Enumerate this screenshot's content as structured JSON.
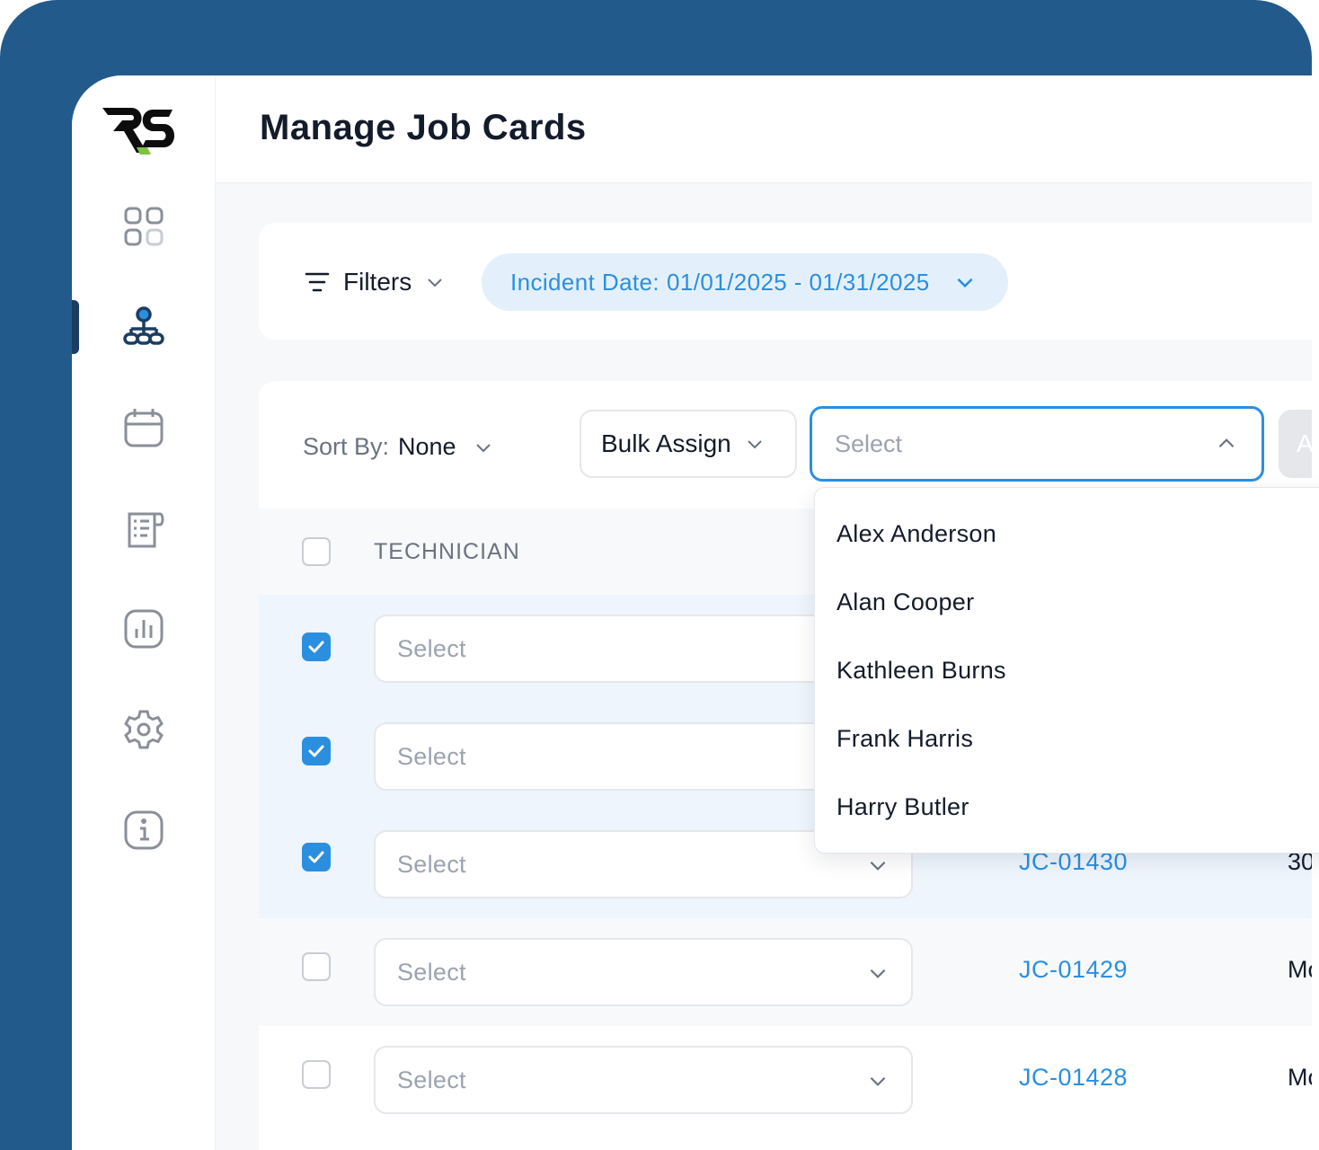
{
  "header": {
    "title": "Manage Job Cards"
  },
  "sidebar": {
    "items": [
      {
        "name": "dashboard",
        "icon": "grid-icon"
      },
      {
        "name": "job-cards",
        "icon": "org-chart-icon",
        "active": true
      },
      {
        "name": "calendar",
        "icon": "calendar-icon"
      },
      {
        "name": "documents",
        "icon": "document-icon"
      },
      {
        "name": "reports",
        "icon": "bar-chart-icon"
      },
      {
        "name": "settings",
        "icon": "gear-icon"
      },
      {
        "name": "info",
        "icon": "info-icon"
      }
    ]
  },
  "filters": {
    "label": "Filters",
    "date_chip_label": "Incident Date:",
    "date_chip_value": "01/01/2025 - 01/31/2025"
  },
  "toolbar": {
    "sort_label": "Sort By:",
    "sort_value": "None",
    "bulk_assign_label": "Bulk Assign",
    "technician_select_placeholder": "Select",
    "apply_label": "A"
  },
  "table": {
    "header_technician": "TECHNICIAN",
    "rows": [
      {
        "checked": true,
        "technician": "Select",
        "job_id": "",
        "extra": ""
      },
      {
        "checked": true,
        "technician": "Select",
        "job_id": "",
        "extra": ""
      },
      {
        "checked": true,
        "technician": "Select",
        "job_id": "JC-01430",
        "extra": "30"
      },
      {
        "checked": false,
        "technician": "Select",
        "job_id": "JC-01429",
        "extra": "Mo"
      },
      {
        "checked": false,
        "technician": "Select",
        "job_id": "JC-01428",
        "extra": "Mo"
      }
    ]
  },
  "dropdown": {
    "options": [
      "Alex Anderson",
      "Alan Cooper",
      "Kathleen Burns",
      "Frank Harris",
      "Harry Butler"
    ]
  },
  "colors": {
    "frame": "#235a8c",
    "accent": "#2b8fe0",
    "nav_active": "#1b3d62",
    "logo_green": "#7dc142"
  }
}
